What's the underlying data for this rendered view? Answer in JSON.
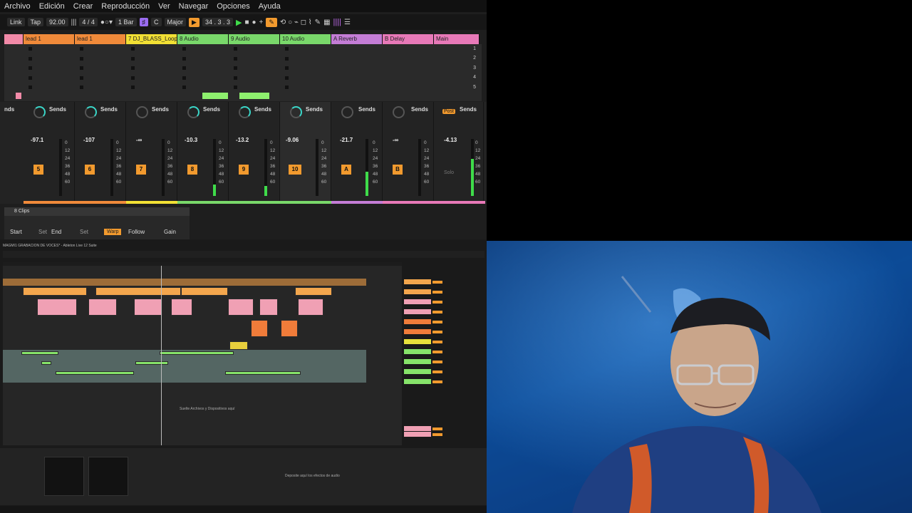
{
  "menu": [
    "Archivo",
    "Edición",
    "Crear",
    "Reproducción",
    "Ver",
    "Navegar",
    "Opciones",
    "Ayuda"
  ],
  "transport": {
    "link": "Link",
    "tap": "Tap",
    "tempo": "92.00",
    "signature": "4 / 4",
    "quant": "1 Bar",
    "key": "C",
    "scale": "Major",
    "position": "34 . 3 . 3"
  },
  "tracks": [
    {
      "name": "",
      "color": "#f28aa8"
    },
    {
      "name": "lead 1",
      "color": "#f08a3a"
    },
    {
      "name": "lead 1",
      "color": "#f08a3a"
    },
    {
      "name": "7 DJ_BLASS_Loop",
      "color": "#f2e034"
    },
    {
      "name": "8 Audio",
      "color": "#79d86a"
    },
    {
      "name": "9 Audio",
      "color": "#79d86a"
    },
    {
      "name": "10 Audio",
      "color": "#79d86a"
    },
    {
      "name": "A Reverb",
      "color": "#c47dd6"
    },
    {
      "name": "B Delay",
      "color": "#e879b8"
    },
    {
      "name": "Main",
      "color": "#e879b8"
    }
  ],
  "scenes": [
    "1",
    "2",
    "3",
    "4",
    "5"
  ],
  "mixer": {
    "sends_label": "Sends",
    "send_a": "A",
    "send_b": "B",
    "post": "Post",
    "solo_label": "S",
    "solo_text": "Solo",
    "strips": [
      {
        "vol": "-97.1",
        "num": "5"
      },
      {
        "vol": "-107",
        "num": "6"
      },
      {
        "vol": "-∞",
        "num": "7"
      },
      {
        "vol": "-10.3",
        "num": "8"
      },
      {
        "vol": "-13.2",
        "num": "9"
      },
      {
        "vol": "-9.06",
        "num": "10"
      },
      {
        "vol": "-21.7",
        "num": "A"
      },
      {
        "vol": "-∞",
        "num": "B"
      },
      {
        "vol": "-4.13",
        "num": ""
      }
    ],
    "scale": [
      "0",
      "12",
      "24",
      "36",
      "48",
      "60"
    ],
    "partial_left": "nds"
  },
  "detail": {
    "title": "8 Clips",
    "start": "Start",
    "set1": "Set",
    "end": "End",
    "set2": "Set",
    "warp": "Warp",
    "follow": "Follow",
    "gain": "Gain"
  },
  "embed": {
    "title": "MAGMI1 GRABACION DE VOCES* - Ableton Live 12 Suite",
    "drop_arrangement": "Suelte Archivos y Dispositivos aquí",
    "drop_effects": "Deposite aquí los efectos de audio"
  }
}
